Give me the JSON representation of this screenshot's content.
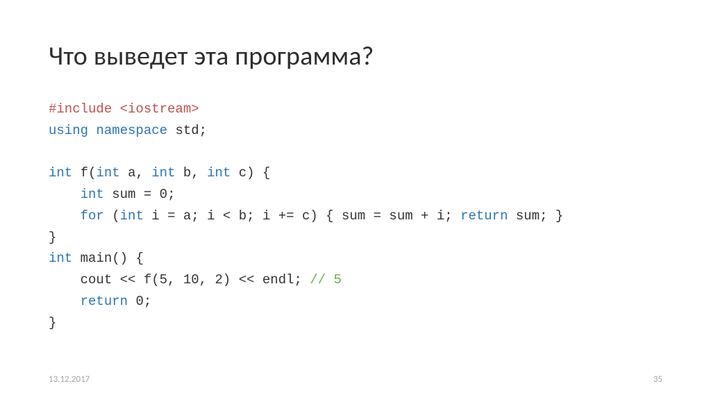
{
  "title": "Что выведет эта программа?",
  "footer": {
    "date": "13.12.2017",
    "page": "35"
  },
  "code": {
    "l1": {
      "pre": "#include <iostream>"
    },
    "l2": {
      "kw1": "using",
      "kw2": "namespace",
      "id": "std",
      "op": ";"
    },
    "l3": "",
    "l4": {
      "ty": "int",
      "fn": "f",
      "op1": "(",
      "p1t": "int",
      "p1": "a",
      "c1": ", ",
      "p2t": "int",
      "p2": "b",
      "c2": ", ",
      "p3t": "int",
      "p3": "c",
      "op2": ") {"
    },
    "l5": {
      "indent": "    ",
      "ty": "int",
      "sp": " ",
      "id": "sum",
      "op1": " = ",
      "num": "0",
      "op2": ";"
    },
    "l6": {
      "indent": "    ",
      "kw": "for",
      "op1": " (",
      "ty": "int",
      "sp1": " ",
      "id1": "i",
      "op2": " = ",
      "id2": "a",
      "op3": "; ",
      "id3": "i",
      "op4": " < ",
      "id4": "b",
      "op5": "; ",
      "id5": "i",
      "op6": " += ",
      "id6": "c",
      "op7": ") { ",
      "id7": "sum",
      "op8": " = ",
      "id8": "sum",
      "op9": " + ",
      "id9": "i",
      "op10": "; ",
      "kw2": "return",
      "sp2": " ",
      "id10": "sum",
      "op11": "; }"
    },
    "l7": "}",
    "l8": {
      "ty": "int",
      "sp": " ",
      "fn": "main",
      "op": "() {"
    },
    "l9": {
      "indent": "    ",
      "id1": "cout",
      "op1": " << ",
      "id2": "f",
      "op2": "(",
      "n1": "5",
      "c1": ", ",
      "n2": "10",
      "c2": ", ",
      "n3": "2",
      "op3": ") << ",
      "id3": "endl",
      "op4": "; ",
      "cmt": "// 5"
    },
    "l10": {
      "indent": "    ",
      "kw": "return",
      "sp": " ",
      "num": "0",
      "op": ";"
    },
    "l11": "}"
  }
}
